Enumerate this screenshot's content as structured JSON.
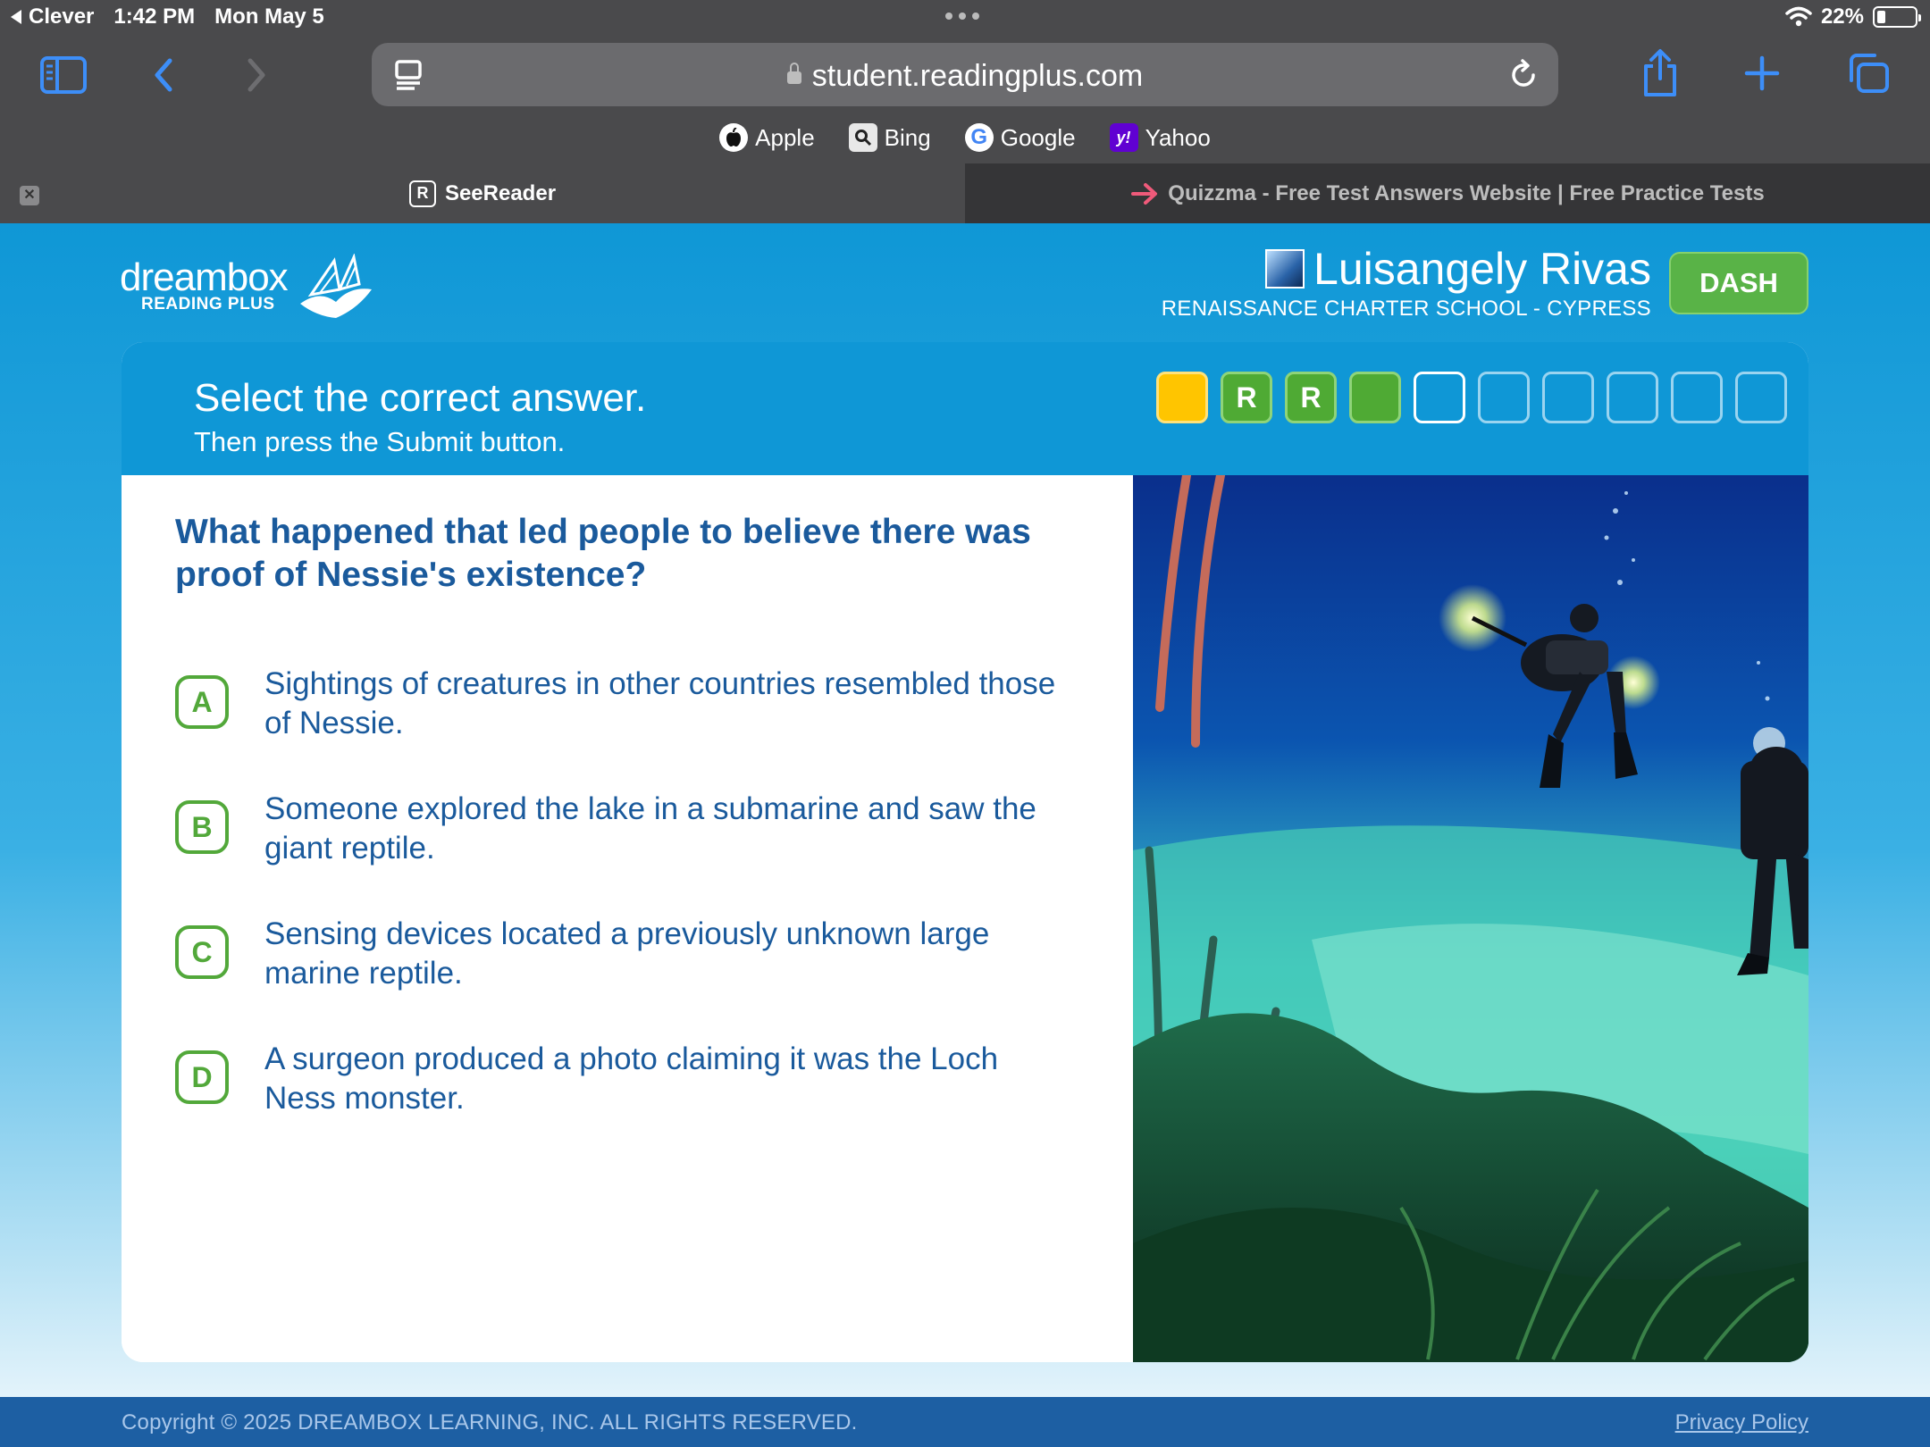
{
  "status": {
    "back_app": "Clever",
    "time": "1:42 PM",
    "date": "Mon May 5",
    "battery": "22%",
    "battery_level": 0.22
  },
  "browser": {
    "url": "student.readingplus.com",
    "bookmarks": [
      {
        "label": "Apple",
        "icon": "apple-icon"
      },
      {
        "label": "Bing",
        "icon": "search-icon"
      },
      {
        "label": "Google",
        "icon": "google-icon"
      },
      {
        "label": "Yahoo",
        "icon": "yahoo-icon"
      }
    ],
    "tabs": [
      {
        "label": "SeeReader",
        "active": true,
        "icon_letter": "R"
      },
      {
        "label": "Quizzma - Free Test Answers Website | Free Practice Tests",
        "active": false
      }
    ]
  },
  "header": {
    "logo_word": "dreambox",
    "logo_sub": "READING PLUS",
    "user_name": "Luisangely Rivas",
    "school": "RENAISSANCE CHARTER SCHOOL - CYPRESS",
    "dash_label": "DASH"
  },
  "card": {
    "instruction": "Select the correct answer.",
    "sub_instruction": "Then press the Submit button.",
    "progress": [
      {
        "label": "",
        "state": "yellow"
      },
      {
        "label": "R",
        "state": "green"
      },
      {
        "label": "R",
        "state": "green"
      },
      {
        "label": "",
        "state": "green"
      },
      {
        "label": "",
        "state": "current"
      },
      {
        "label": "",
        "state": "empty"
      },
      {
        "label": "",
        "state": "empty"
      },
      {
        "label": "",
        "state": "empty"
      },
      {
        "label": "",
        "state": "empty"
      },
      {
        "label": "",
        "state": "empty"
      }
    ],
    "question": "What happened that led people to believe there was proof of Nessie's existence?",
    "options": [
      {
        "letter": "A",
        "text": "Sightings of creatures in other countries resembled those of Nessie."
      },
      {
        "letter": "B",
        "text": "Someone explored the lake in a submarine and saw the giant reptile."
      },
      {
        "letter": "C",
        "text": "Sensing devices located a previously unknown large marine reptile."
      },
      {
        "letter": "D",
        "text": "A surgeon produced a photo claiming it was the Loch Ness monster."
      }
    ]
  },
  "footer": {
    "copyright": "Copyright © 2025 DREAMBOX LEARNING, INC. ALL RIGHTS RESERVED.",
    "privacy": "Privacy Policy"
  },
  "colors": {
    "brand_blue": "#0f97d6",
    "text_blue": "#1a5a9c",
    "answer_green": "#52a83a",
    "progress_yellow": "#ffc500"
  }
}
